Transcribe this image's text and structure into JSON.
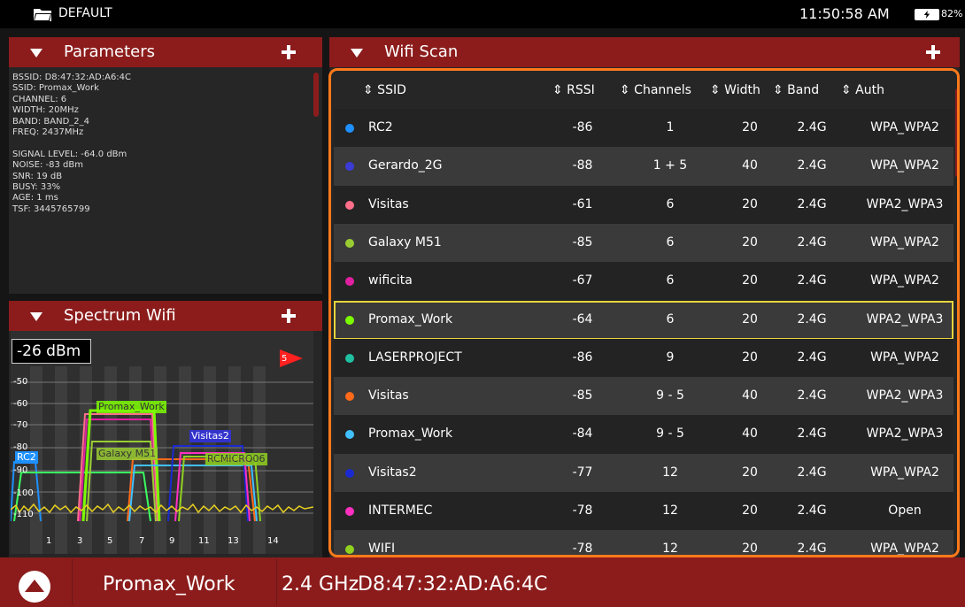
{
  "topbar": {
    "title": "DEFAULT",
    "time": "11:50:58 AM",
    "battery": "82%"
  },
  "parameters": {
    "title": "Parameters",
    "lines": [
      "BSSID: D8:47:32:AD:A6:4C",
      "SSID: Promax_Work",
      "CHANNEL: 6",
      "WIDTH: 20MHz",
      "BAND: BAND_2_4",
      "FREQ: 2437MHz",
      "",
      "SIGNAL LEVEL: -64.0 dBm",
      "NOISE: -83 dBm",
      "SNR: 19 dB",
      "BUSY: 33%",
      "AGE: 1 ms",
      "TSF: 3445765799"
    ]
  },
  "spectrum": {
    "title": "Spectrum Wifi",
    "level": "-26 dBm",
    "marker": "5",
    "db_labels": [
      "-50",
      "-60",
      "-70",
      "-80",
      "-90",
      "-100",
      "-110"
    ],
    "channels": [
      "1",
      "3",
      "5",
      "7",
      "9",
      "11",
      "13",
      "14"
    ],
    "labels": [
      "Promax_Work",
      "Visitas2",
      "RC2",
      "Galaxy M51",
      "RCMICRO06"
    ]
  },
  "scan": {
    "title": "Wifi Scan",
    "headers": {
      "ssid": "⇕ SSID",
      "rssi": "⇕ RSSI",
      "channels": "⇕ Channels",
      "width": "⇕ Width",
      "band": "⇕ Band",
      "auth": "⇕ Auth"
    },
    "rows": [
      {
        "ssid": "RC2",
        "rssi": "-86",
        "channels": "1",
        "width": "20",
        "band": "2.4G",
        "auth": "WPA_WPA2",
        "color": "#1e90ff"
      },
      {
        "ssid": "Gerardo_2G",
        "rssi": "-88",
        "channels": "1 + 5",
        "width": "40",
        "band": "2.4G",
        "auth": "WPA_WPA2",
        "color": "#3b3bd6"
      },
      {
        "ssid": "Visitas",
        "rssi": "-61",
        "channels": "6",
        "width": "20",
        "band": "2.4G",
        "auth": "WPA2_WPA3",
        "color": "#ff6f8a"
      },
      {
        "ssid": "Galaxy M51",
        "rssi": "-85",
        "channels": "6",
        "width": "20",
        "band": "2.4G",
        "auth": "WPA_WPA2",
        "color": "#9acd32"
      },
      {
        "ssid": "wificita",
        "rssi": "-67",
        "channels": "6",
        "width": "20",
        "band": "2.4G",
        "auth": "WPA_WPA2",
        "color": "#e020a0"
      },
      {
        "ssid": "Promax_Work",
        "rssi": "-64",
        "channels": "6",
        "width": "20",
        "band": "2.4G",
        "auth": "WPA2_WPA3",
        "color": "#7cfc00",
        "selected": true
      },
      {
        "ssid": "LASERPROJECT",
        "rssi": "-86",
        "channels": "9",
        "width": "20",
        "band": "2.4G",
        "auth": "WPA_WPA2",
        "color": "#20c0a0"
      },
      {
        "ssid": "Visitas",
        "rssi": "-85",
        "channels": "9 - 5",
        "width": "40",
        "band": "2.4G",
        "auth": "WPA2_WPA3",
        "color": "#ff6a1a"
      },
      {
        "ssid": "Promax_Work",
        "rssi": "-84",
        "channels": "9 - 5",
        "width": "40",
        "band": "2.4G",
        "auth": "WPA2_WPA3",
        "color": "#40c0ff"
      },
      {
        "ssid": "Visitas2",
        "rssi": "-77",
        "channels": "12",
        "width": "20",
        "band": "2.4G",
        "auth": "WPA_WPA2",
        "color": "#1a2ad0"
      },
      {
        "ssid": "INTERMEC",
        "rssi": "-78",
        "channels": "12",
        "width": "20",
        "band": "2.4G",
        "auth": "Open",
        "color": "#ff30c0"
      },
      {
        "ssid": "WIFI",
        "rssi": "-78",
        "channels": "12",
        "width": "20",
        "band": "2.4G",
        "auth": "WPA_WPA2",
        "color": "#90d020"
      }
    ]
  },
  "bottombar": {
    "network": "Promax_Work",
    "band": "2.4 GHz",
    "bssid": "D8:47:32:AD:A6:4C"
  },
  "colors": {
    "header": "#8c1c1c",
    "accent": "#ff7a1a",
    "selection": "#e6d43c"
  }
}
